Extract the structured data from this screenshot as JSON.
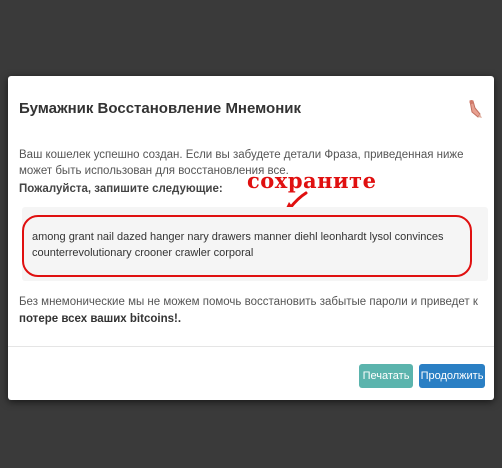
{
  "modal": {
    "title": "Бумажник Восстановление Мнемоник",
    "success_text": "Ваш кошелек успешно создан. Если вы забудете детали Фраза, приведенная ниже может быть использован для восстановления все.",
    "prompt": "Пожалуйста, запишите следующие:",
    "annotation": "сохраните",
    "mnemonic": "among grant nail dazed hanger nary drawers manner diehl leonhardt lysol convinces counterrevolutionary crooner crawler corporal",
    "warning_prefix": "Без мнемонические мы не можем помочь восстановить забытые пароли и приведет к ",
    "warning_bold": "потере всех ваших bitcoins",
    "warning_suffix": "!.",
    "buttons": {
      "print": "Печатать",
      "continue": "Продолжить"
    }
  },
  "colors": {
    "overlay": "#3a3a3a",
    "annotation": "#e01010",
    "print_button": "#5bb4ad",
    "continue_button": "#2a7fc4"
  },
  "icons": {
    "close": "close-icon"
  }
}
